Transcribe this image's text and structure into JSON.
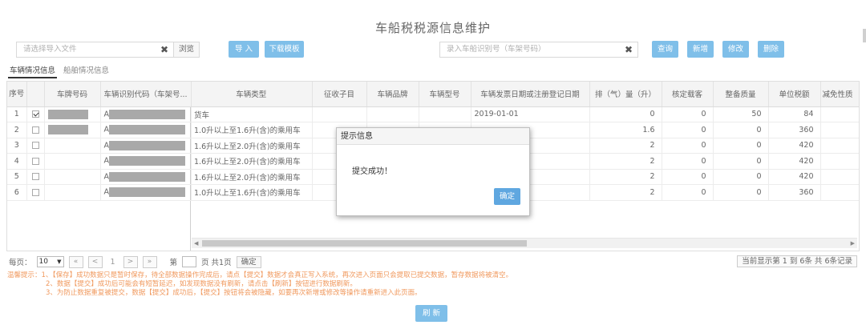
{
  "page": {
    "title": "车船税税源信息维护"
  },
  "toolbar": {
    "file_placeholder": "请选择导入文件",
    "clear_symbol": "✖",
    "browse_label": "浏览",
    "import_label": "导 入",
    "download_template_label": "下载模板",
    "search_placeholder": "录入车船识别号（车架号码）",
    "query_label": "查询",
    "add_label": "新增",
    "modify_label": "修改",
    "delete_label": "删除"
  },
  "tabs": [
    {
      "label": "车辆情况信息",
      "active": true
    },
    {
      "label": "船舶情况信息",
      "active": false
    }
  ],
  "table": {
    "headers": {
      "seq": "序号",
      "plate": "车牌号码",
      "vin": "车辆识别代码（车架号...",
      "vehicle_type": "车辆类型",
      "tax_item": "征收子目",
      "brand": "车辆品牌",
      "model": "车辆型号",
      "issue_date": "车辆发票日期或注册登记日期",
      "displacement": "排（气）量（升）",
      "seats": "核定载客",
      "curb_weight": "整备质量",
      "unit_tax": "单位税额",
      "exemption": "减免性质"
    },
    "rows": [
      {
        "seq": "1",
        "checked": true,
        "vin_prefix": "A",
        "vehicle_type": "货车",
        "issue_date": "2019-01-01",
        "displacement": "0",
        "seats": "0",
        "curb_weight": "50",
        "unit_tax": "84"
      },
      {
        "seq": "2",
        "checked": false,
        "vin_prefix": "A",
        "vehicle_type": "1.0升以上至1.6升(含)的乘用车",
        "issue_date": "",
        "displacement": "1.6",
        "seats": "0",
        "curb_weight": "0",
        "unit_tax": "360"
      },
      {
        "seq": "3",
        "checked": false,
        "vin_prefix": "A",
        "vehicle_type": "1.6升以上至2.0升(含)的乘用车",
        "issue_date": "",
        "displacement": "2",
        "seats": "0",
        "curb_weight": "0",
        "unit_tax": "420"
      },
      {
        "seq": "4",
        "checked": false,
        "vin_prefix": "A",
        "vehicle_type": "1.6升以上至2.0升(含)的乘用车",
        "issue_date": "",
        "displacement": "2",
        "seats": "0",
        "curb_weight": "0",
        "unit_tax": "420"
      },
      {
        "seq": "5",
        "checked": false,
        "vin_prefix": "A",
        "vehicle_type": "1.6升以上至2.0升(含)的乘用车",
        "issue_date": "",
        "displacement": "2",
        "seats": "0",
        "curb_weight": "0",
        "unit_tax": "420"
      },
      {
        "seq": "6",
        "checked": false,
        "vin_prefix": "A",
        "vehicle_type": "1.0升以上至1.6升(含)的乘用车",
        "issue_date": "",
        "displacement": "2",
        "seats": "0",
        "curb_weight": "0",
        "unit_tax": "360"
      }
    ]
  },
  "pager": {
    "per_page_label": "每页：",
    "per_page_value": "10",
    "first": "«",
    "prev": "<",
    "current": "1",
    "next": ">",
    "last": "»",
    "goto_prefix": "第",
    "goto_suffix": "页 共1页",
    "confirm_label": "确定",
    "summary": "当前显示第  1 到  6条  共  6条记录"
  },
  "notes": {
    "line1": "温馨提示：1、【保存】成功数据只是暂时保存，待全部数据操作完成后，请点【提交】数据才会真正写入系统，再次进入页面只会提取已提交数据，暂存数据将被清空。",
    "line2": "2、数据【提交】成功后可能会有短暂延迟，如发现数据没有刷新，请点击【刷新】按钮进行数据刷新。",
    "line3": "3、为防止数据重复被提交，数据【提交】成功后，【提交】按钮将会被隐藏，如要再次新增或修改等操作请重新进入此页面。"
  },
  "refresh_label": "刷 新",
  "dialog": {
    "title": "提示信息",
    "message": "提交成功！",
    "ok_label": "确定"
  },
  "colors": {
    "primary_button": "#7fbfe9",
    "dialog_button": "#5fa7e0",
    "notice_text": "#f0995e"
  }
}
